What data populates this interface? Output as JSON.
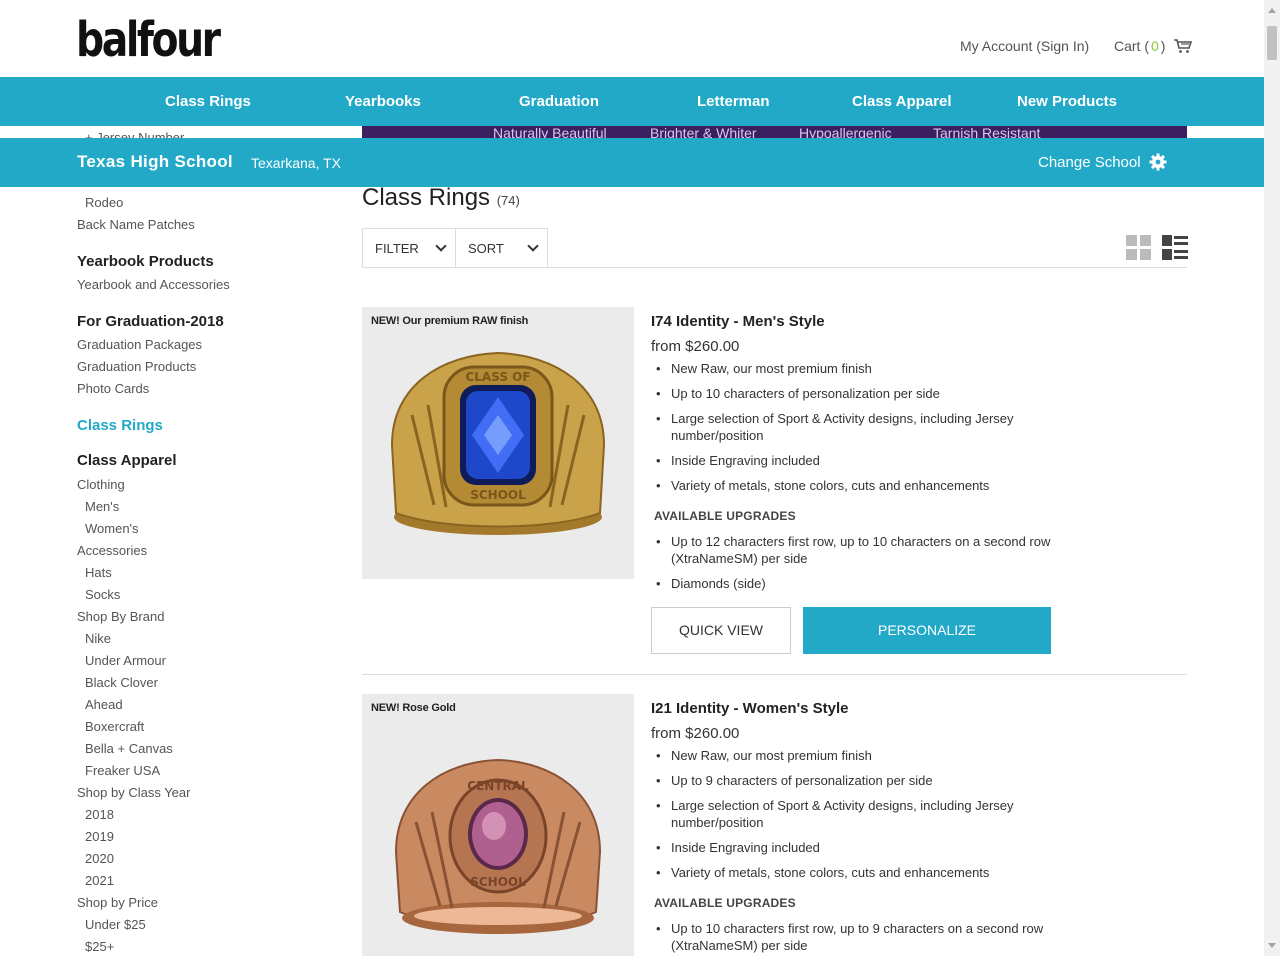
{
  "header": {
    "logo": "balfour",
    "account_label": "My Account (Sign In)",
    "cart_label": "Cart (",
    "cart_count": "0",
    "cart_close": ")",
    "cart_icon": "cart-icon"
  },
  "nav": {
    "items": [
      {
        "label": "Class Rings"
      },
      {
        "label": "Yearbooks"
      },
      {
        "label": "Graduation"
      },
      {
        "label": "Letterman"
      },
      {
        "label": "Class Apparel"
      },
      {
        "label": "New Products"
      }
    ]
  },
  "promo": {
    "items": [
      "Naturally Beautiful",
      "Brighter & Whiter",
      "Hypoallergenic",
      "Tarnish Resistant"
    ]
  },
  "school": {
    "name": "Texas High School",
    "location": "Texarkana, TX",
    "change_label": "Change School",
    "change_icon": "gear-icon"
  },
  "sidebar": {
    "peek": "+ Jersey Number",
    "items": [
      {
        "label": "Rodeo",
        "level": 2
      },
      {
        "label": "Back Name Patches",
        "level": 1
      },
      {
        "label": "Yearbook Products",
        "level": 0
      },
      {
        "label": "Yearbook and Accessories",
        "level": 1
      },
      {
        "label": "For Graduation-2018",
        "level": 0
      },
      {
        "label": "Graduation Packages",
        "level": 1
      },
      {
        "label": "Graduation Products",
        "level": 1
      },
      {
        "label": "Photo Cards",
        "level": 1
      },
      {
        "label": "Class Rings",
        "level": 0,
        "active": true
      },
      {
        "label": "Class Apparel",
        "level": 0
      },
      {
        "label": "Clothing",
        "level": 1
      },
      {
        "label": "Men's",
        "level": 2
      },
      {
        "label": "Women's",
        "level": 2
      },
      {
        "label": "Accessories",
        "level": 1
      },
      {
        "label": "Hats",
        "level": 2
      },
      {
        "label": "Socks",
        "level": 2
      },
      {
        "label": "Shop By Brand",
        "level": 1
      },
      {
        "label": "Nike",
        "level": 2
      },
      {
        "label": "Under Armour",
        "level": 2
      },
      {
        "label": "Black Clover",
        "level": 2
      },
      {
        "label": "Ahead",
        "level": 2
      },
      {
        "label": "Boxercraft",
        "level": 2
      },
      {
        "label": "Bella + Canvas",
        "level": 2
      },
      {
        "label": "Freaker USA",
        "level": 2
      },
      {
        "label": "Shop by Class Year",
        "level": 1
      },
      {
        "label": "2018",
        "level": 2
      },
      {
        "label": "2019",
        "level": 2
      },
      {
        "label": "2020",
        "level": 2
      },
      {
        "label": "2021",
        "level": 2
      },
      {
        "label": "Shop by Price",
        "level": 1
      },
      {
        "label": "Under $25",
        "level": 2
      },
      {
        "label": "$25+",
        "level": 2
      }
    ]
  },
  "main": {
    "title": "Class Rings",
    "count": "(74)",
    "filter_label": "FILTER",
    "sort_label": "SORT",
    "grid_view_icon": "grid-view-icon",
    "list_view_icon": "list-view-icon"
  },
  "products": [
    {
      "badge": "NEW! Our premium RAW finish",
      "name": "I74 Identity - Men's Style",
      "price": "from $260.00",
      "features": [
        "New Raw, our most premium finish",
        "Up to 10 characters of personalization per side",
        "Large selection of Sport & Activity designs, including Jersey number/position",
        "Inside Engraving included",
        "Variety of metals, stone colors, cuts and enhancements"
      ],
      "upgrades_label": "AVAILABLE UPGRADES",
      "upgrades": [
        "Up to 12 characters first row, up to 10 characters on a second row (XtraNameSM) per side",
        "Diamonds (side)"
      ],
      "quick_view": "QUICK VIEW",
      "personalize": "PERSONALIZE",
      "stone_color": "#1f47c9",
      "metal_color": "#c9a24a"
    },
    {
      "badge": "NEW! Rose Gold",
      "name": "I21 Identity - Women's Style",
      "price": "from $260.00",
      "features": [
        "New Raw, our most premium finish",
        "Up to 9 characters of personalization per side",
        "Large selection of Sport & Activity designs, including Jersey number/position",
        "Inside Engraving included",
        "Variety of metals, stone colors, cuts and enhancements"
      ],
      "upgrades_label": "AVAILABLE UPGRADES",
      "upgrades": [
        "Up to 10 characters first row, up to 9 characters on a second row (XtraNameSM) per side"
      ],
      "stone_color": "#b0608e",
      "metal_color": "#c98a62"
    }
  ],
  "colors": {
    "brand": "#22a9c8",
    "promo": "#3b1f5e",
    "cart_count": "#8dc63f"
  }
}
